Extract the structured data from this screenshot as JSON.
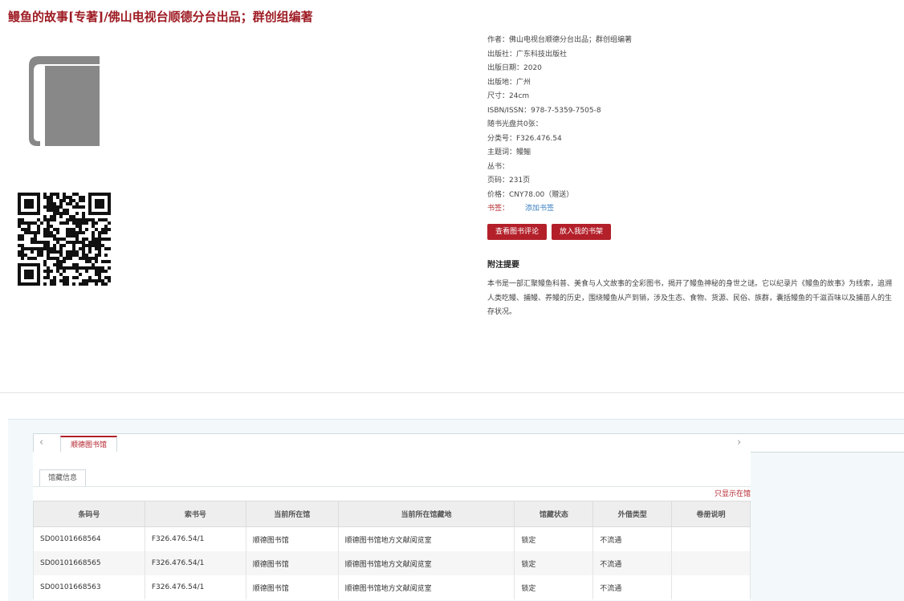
{
  "book": {
    "title": "鳗鱼的故事[专著]/佛山电视台顺德分台出品；群创组编著"
  },
  "meta": {
    "author": "作者：佛山电视台顺德分台出品；群创组编著",
    "publisher": "出版社：广东科技出版社",
    "pub_date": "出版日期：2020",
    "pub_place": "出版地：广州",
    "size": "尺寸：24cm",
    "isbn": "ISBN/ISSN：978-7-5359-7505-8",
    "disc": "随书光盘共0张：",
    "class_no": "分类号：F326.476.54",
    "subject": "主题词：鳗鲡",
    "series": "丛书：",
    "pages": "页码：231页",
    "price": "价格：CNY78.00（赠送）",
    "bookmark_label": "书签：",
    "bookmark_link": "添加书签"
  },
  "buttons": {
    "review": "查看图书评论",
    "shelf": "放入我的书架"
  },
  "notes": {
    "heading": "附注提要",
    "text": "本书是一部汇聚鳗鱼科普、美食与人文故事的全彩图书，揭开了鳗鱼神秘的身世之谜。它以纪录片《鳗鱼的故事》为线索，追溯人类吃鳗、捕鳗、养鳗的历史，围绕鳗鱼从产到销，涉及生态、食物、货源、民俗、族群，囊括鳗鱼的千滋百味以及捕苗人的生存状况。"
  },
  "holdings": {
    "library_tab": "顺德图书馆",
    "sub_tab": "馆藏信息",
    "only_this": "只显示在馆",
    "columns": [
      "条码号",
      "索书号",
      "当前所在馆",
      "当前所在馆藏地",
      "馆藏状态",
      "外借类型",
      "卷册说明"
    ],
    "rows": [
      [
        "SD00101668564",
        "F326.476.54/1",
        "顺德图书馆",
        "顺德图书馆地方文献阅览室",
        "锁定",
        "不流通",
        ""
      ],
      [
        "SD00101668565",
        "F326.476.54/1",
        "顺德图书馆",
        "顺德图书馆地方文献阅览室",
        "锁定",
        "不流通",
        ""
      ],
      [
        "SD00101668563",
        "F326.476.54/1",
        "顺德图书馆",
        "顺德图书馆地方文献阅览室",
        "锁定",
        "不流通",
        ""
      ]
    ]
  },
  "colors": {
    "accent": "#b3202a",
    "title": "#9e1c24",
    "link": "#3a7fc1"
  }
}
